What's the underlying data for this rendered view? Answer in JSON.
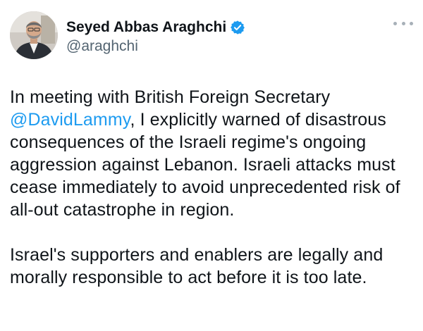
{
  "author": {
    "display_name": "Seyed Abbas Araghchi",
    "handle": "@araghchi",
    "verified_icon": "verified-badge-icon",
    "avatar_icon": "profile-photo"
  },
  "menu": {
    "icon": "more-options-icon"
  },
  "tweet": {
    "para1_before_mention": "In meeting with British Foreign Secretary",
    "mention": "@DavidLammy",
    "para1_after_mention": ", I explicitly warned of disastrous consequences of the Israeli regime's ongoing aggression against Lebanon. Israeli attacks must cease immediately to avoid unprecedented risk of all-out catastrophe in region.",
    "para2": "Israel's supporters and enablers are legally and morally responsible to act before it is too late."
  },
  "colors": {
    "mention": "#1d9bf0",
    "verified": "#1d9bf0",
    "handle": "#536471",
    "text": "#0f1419"
  }
}
